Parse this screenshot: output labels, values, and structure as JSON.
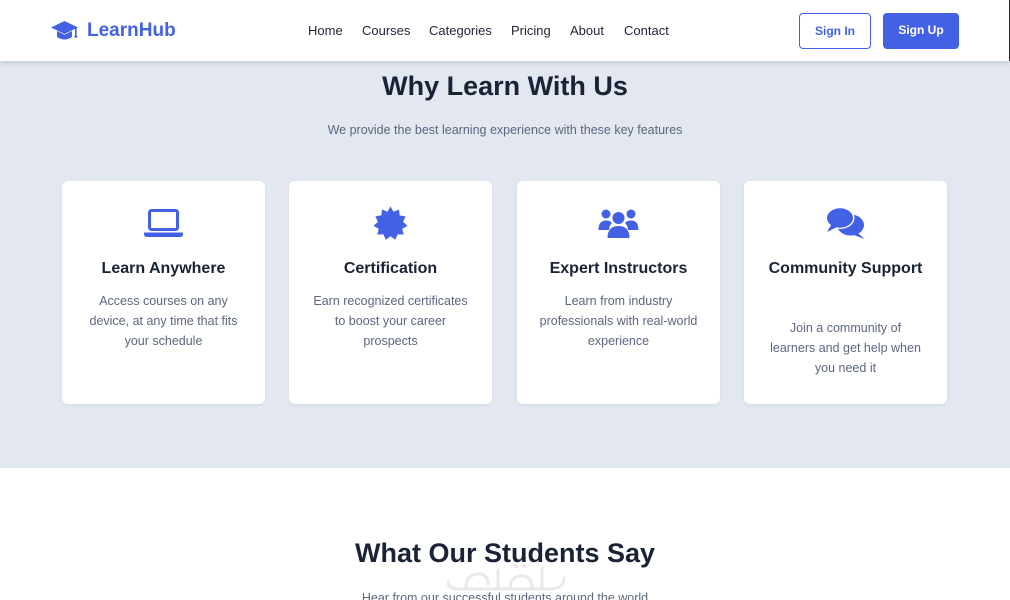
{
  "brand": {
    "name": "LearnHub",
    "icon": "graduation-cap-icon",
    "color": "#4361e4"
  },
  "nav": {
    "links": [
      {
        "label": "Home"
      },
      {
        "label": "Courses"
      },
      {
        "label": "Categories"
      },
      {
        "label": "Pricing"
      },
      {
        "label": "About"
      },
      {
        "label": "Contact"
      }
    ],
    "sign_in": "Sign In",
    "sign_up": "Sign Up"
  },
  "features": {
    "title": "Why Learn With Us",
    "subtitle": "We provide the best learning experience with these key features",
    "background": "#e2e7f0",
    "cards": [
      {
        "icon": "laptop-icon",
        "title": "Learn Anywhere",
        "description": "Access courses on any device, at any time that fits your schedule"
      },
      {
        "icon": "certificate-icon",
        "title": "Certification",
        "description": "Earn recognized certificates to boost your career prospects"
      },
      {
        "icon": "users-icon",
        "title": "Expert Instructors",
        "description": "Learn from industry professionals with real-world experience"
      },
      {
        "icon": "comments-icon",
        "title": "Community Support",
        "description": "Join a community of learners and get help when you need it"
      }
    ]
  },
  "testimonials": {
    "title": "What Our Students Say",
    "subtitle": "Hear from our successful students around the world"
  }
}
